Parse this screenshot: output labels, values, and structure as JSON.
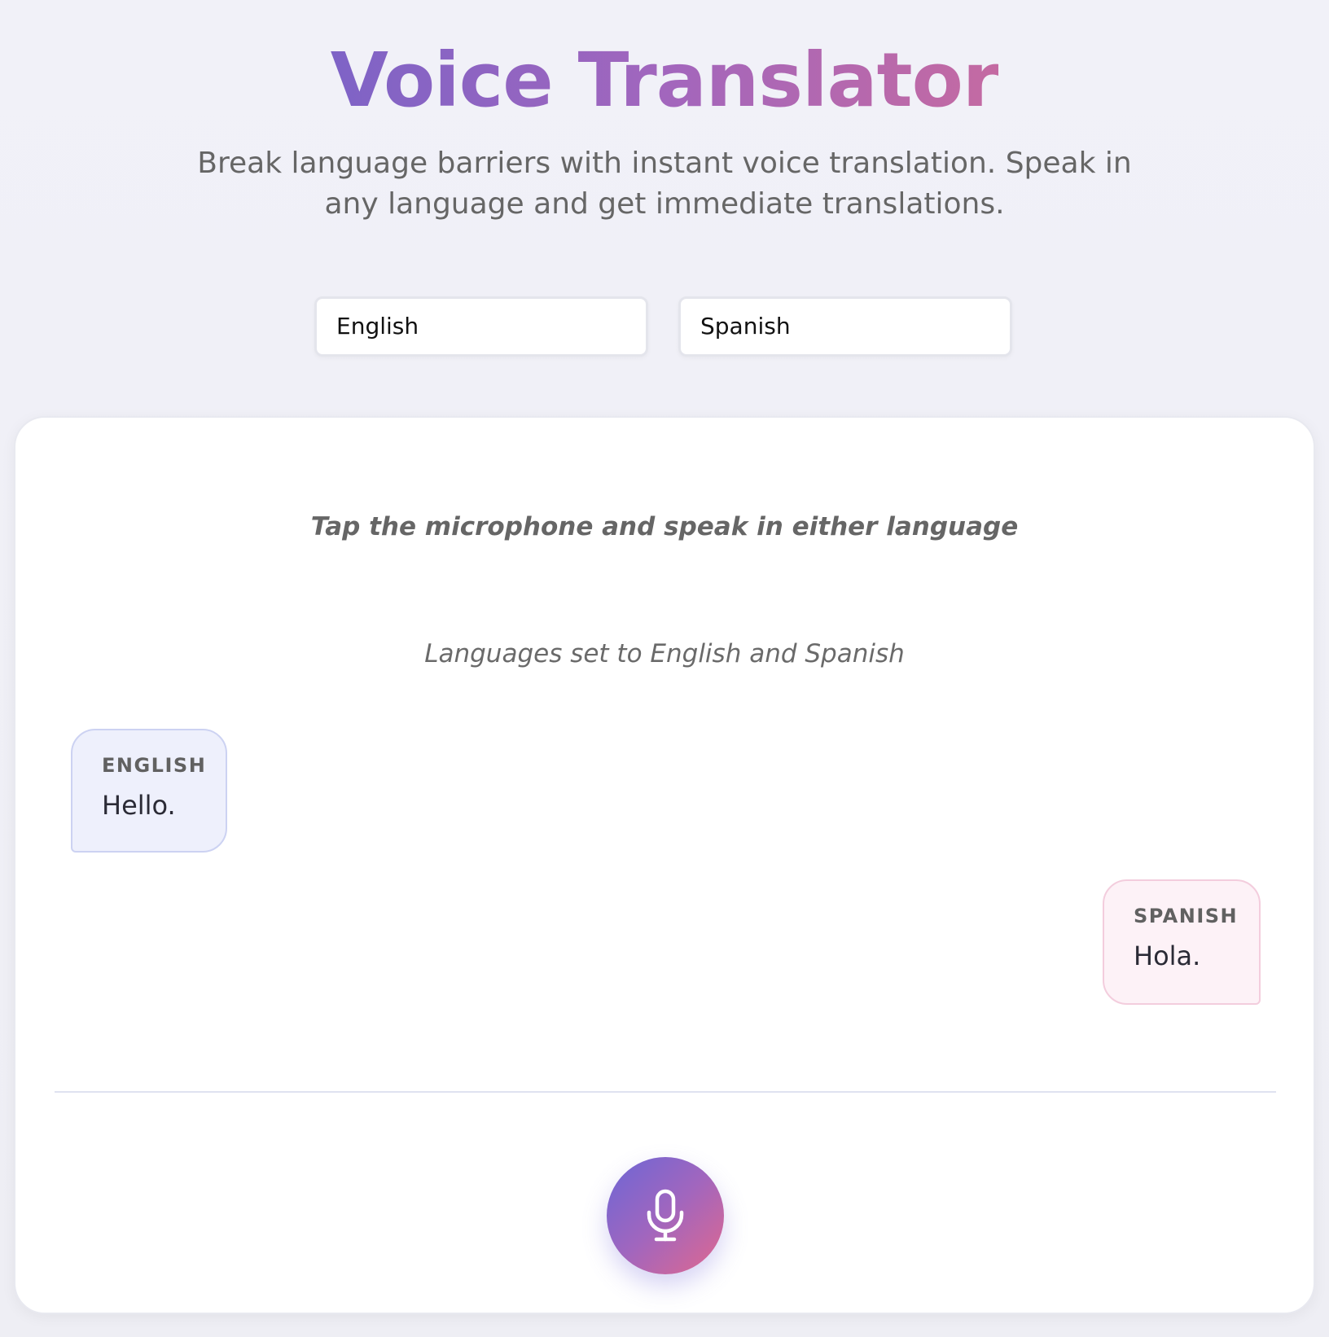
{
  "header": {
    "title": "Voice Translator",
    "subtitle": "Break language barriers with instant voice translation. Speak in any language and get immediate translations."
  },
  "language_selectors": {
    "source": "English",
    "target": "Spanish"
  },
  "conversation": {
    "instruction": "Tap the microphone and speak in either language",
    "status": "Languages set to English and Spanish",
    "messages": [
      {
        "language": "ENGLISH",
        "text": "Hello."
      },
      {
        "language": "SPANISH",
        "text": "Hola."
      }
    ]
  },
  "mic_button": {
    "icon": "microphone-icon"
  },
  "colors": {
    "title_gradient_start": "#7e63c6",
    "title_gradient_end": "#c46aa2",
    "mic_gradient_start": "#6c66d6",
    "mic_gradient_end": "#e1688e",
    "english_bubble_bg": "#eef0fc",
    "spanish_bubble_bg": "#fdf2f7"
  }
}
